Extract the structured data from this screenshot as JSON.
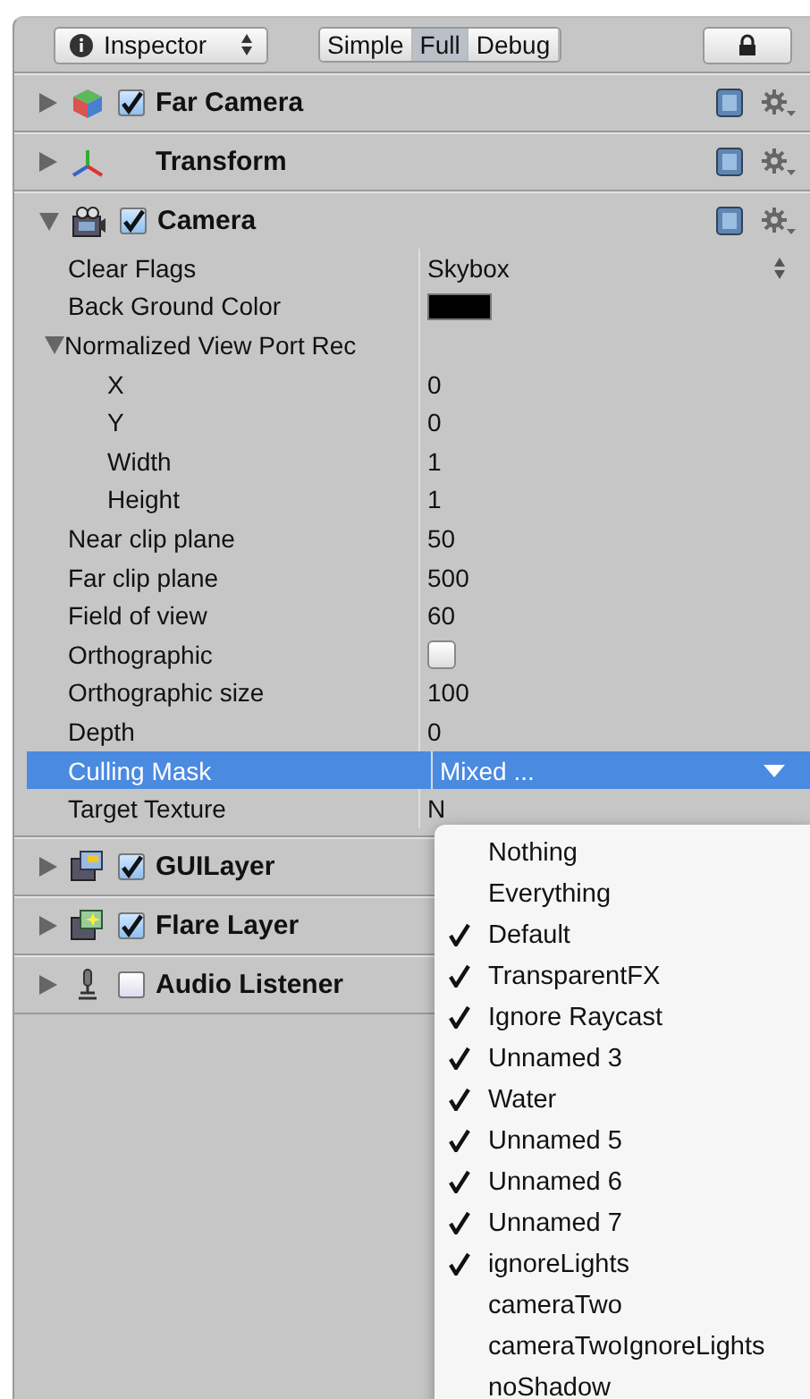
{
  "toolbar": {
    "panel_dropdown": {
      "label": "Inspector"
    },
    "modes": [
      {
        "label": "Simple",
        "selected": false
      },
      {
        "label": "Full",
        "selected": true
      },
      {
        "label": "Debug",
        "selected": false
      }
    ],
    "locked": true
  },
  "components": [
    {
      "name": "Far Camera",
      "kind": "cube",
      "expanded": false,
      "checkbox": true,
      "checked": true,
      "tools": true
    },
    {
      "name": "Transform",
      "kind": "axes",
      "expanded": false,
      "checkbox": false,
      "tools": true
    },
    {
      "name": "Camera",
      "kind": "camera",
      "expanded": true,
      "checkbox": true,
      "checked": true,
      "tools": true,
      "properties": [
        {
          "kind": "dropdown",
          "label": "Clear Flags",
          "value": "Skybox",
          "selected": false
        },
        {
          "kind": "color",
          "label": "Back Ground Color",
          "color": "#000000",
          "selected": false
        },
        {
          "kind": "foldout",
          "label": "Normalized View Port Rec",
          "expanded": true,
          "selected": false,
          "children": [
            {
              "kind": "field",
              "label": "X",
              "value": "0",
              "selected": false
            },
            {
              "kind": "field",
              "label": "Y",
              "value": "0",
              "selected": false
            },
            {
              "kind": "field",
              "label": "Width",
              "value": "1",
              "selected": false
            },
            {
              "kind": "field",
              "label": "Height",
              "value": "1",
              "selected": false
            }
          ]
        },
        {
          "kind": "field",
          "label": "Near clip plane",
          "value": "50",
          "selected": false
        },
        {
          "kind": "field",
          "label": "Far clip plane",
          "value": "500",
          "selected": false
        },
        {
          "kind": "field",
          "label": "Field of view",
          "value": "60",
          "selected": false
        },
        {
          "kind": "checkbox",
          "label": "Orthographic",
          "checked": false,
          "selected": false
        },
        {
          "kind": "field",
          "label": "Orthographic size",
          "value": "100",
          "selected": false
        },
        {
          "kind": "field",
          "label": "Depth",
          "value": "0",
          "selected": false
        },
        {
          "kind": "mask",
          "label": "Culling Mask",
          "value": "Mixed ...",
          "selected": true
        },
        {
          "kind": "field",
          "label": "Target Texture",
          "value": "N",
          "selected": false
        }
      ]
    },
    {
      "name": "GUILayer",
      "kind": "gui-layer",
      "expanded": false,
      "checkbox": true,
      "checked": true,
      "tools": false
    },
    {
      "name": "Flare Layer",
      "kind": "flare-layer",
      "expanded": false,
      "checkbox": true,
      "checked": true,
      "tools": false
    },
    {
      "name": "Audio Listener",
      "kind": "audio",
      "expanded": false,
      "checkbox": true,
      "checked": false,
      "tools": false
    }
  ],
  "culling_mask_menu": [
    {
      "label": "Nothing",
      "checked": false
    },
    {
      "label": "Everything",
      "checked": false
    },
    {
      "label": "Default",
      "checked": true
    },
    {
      "label": "TransparentFX",
      "checked": true
    },
    {
      "label": "Ignore Raycast",
      "checked": true
    },
    {
      "label": "Unnamed 3",
      "checked": true
    },
    {
      "label": "Water",
      "checked": true
    },
    {
      "label": "Unnamed 5",
      "checked": true
    },
    {
      "label": "Unnamed 6",
      "checked": true
    },
    {
      "label": "Unnamed 7",
      "checked": true
    },
    {
      "label": "ignoreLights",
      "checked": true
    },
    {
      "label": "cameraTwo",
      "checked": false
    },
    {
      "label": "cameraTwoIgnoreLights",
      "checked": false
    },
    {
      "label": "noShadow",
      "checked": false
    }
  ]
}
